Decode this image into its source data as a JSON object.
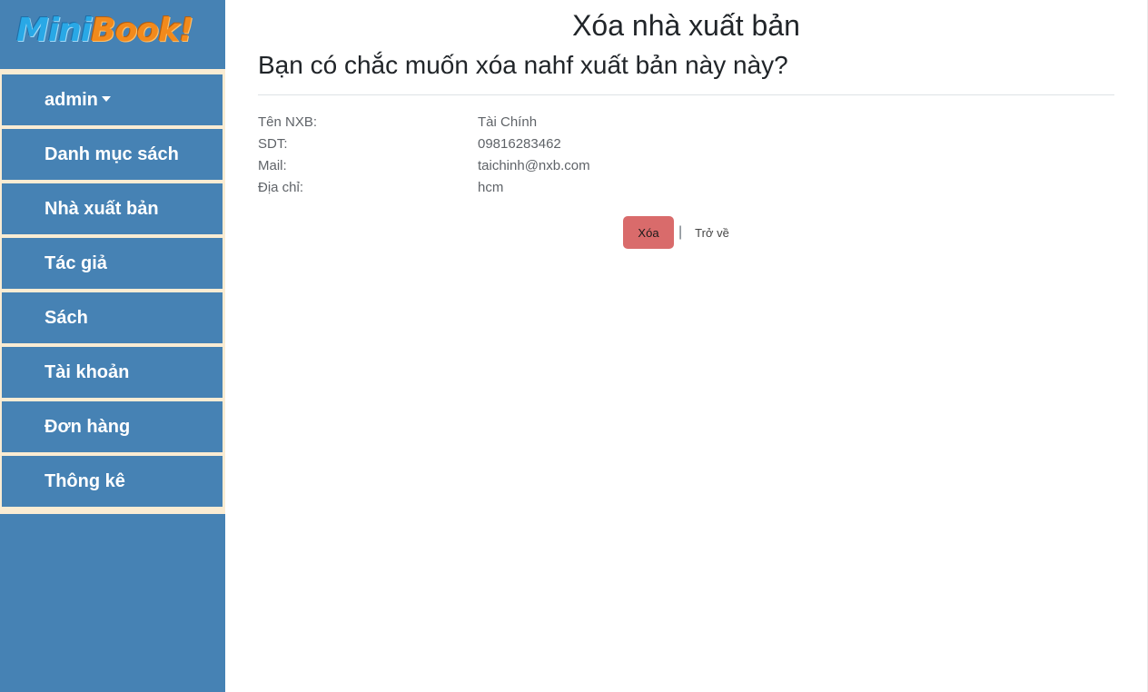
{
  "sidebar": {
    "logo": {
      "part1": "Mini",
      "part2": "Book!"
    },
    "items": [
      {
        "label": "admin",
        "dropdown": true
      },
      {
        "label": "Danh mục sách"
      },
      {
        "label": "Nhà xuất bản"
      },
      {
        "label": "Tác giả"
      },
      {
        "label": "Sách"
      },
      {
        "label": "Tài khoản"
      },
      {
        "label": "Đơn hàng"
      },
      {
        "label": "Thông kê"
      }
    ]
  },
  "main": {
    "title": "Xóa nhà xuất bản",
    "question": "Bạn có chắc muốn xóa nahf xuất bản này này?",
    "details": [
      {
        "label": "Tên NXB:",
        "value": "Tài Chính"
      },
      {
        "label": "SDT:",
        "value": "09816283462"
      },
      {
        "label": "Mail:",
        "value": "taichinh@nxb.com"
      },
      {
        "label": "Địa chỉ:",
        "value": "hcm"
      }
    ],
    "actions": {
      "delete_label": "Xóa",
      "separator": "|",
      "back_label": "Trở về"
    }
  },
  "colors": {
    "sidebar_bg": "#4682b4",
    "sidebar_border": "#faecd3",
    "delete_button": "#d96b6b"
  }
}
